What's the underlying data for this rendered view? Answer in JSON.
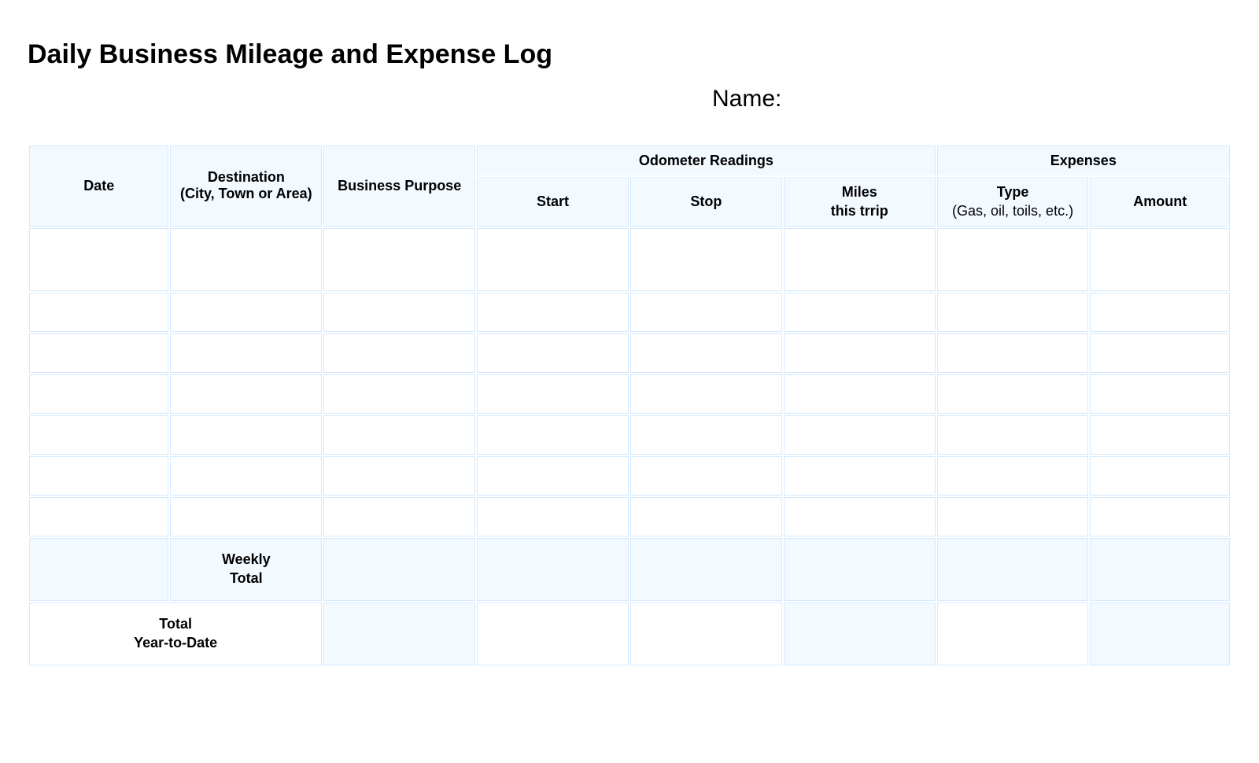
{
  "title": "Daily Business Mileage and Expense Log",
  "name_label": "Name:",
  "headers": {
    "date": "Date",
    "destination_line1": "Destination",
    "destination_line2": "(City, Town or Area)",
    "purpose": "Business Purpose",
    "odometer_group": "Odometer Readings",
    "start": "Start",
    "stop": "Stop",
    "miles_line1": "Miles",
    "miles_line2": "this trrip",
    "expenses_group": "Expenses",
    "type_line1": "Type",
    "type_line2": "(Gas, oil, toils, etc.)",
    "amount": "Amount"
  },
  "rows": [
    {
      "date": "",
      "destination": "",
      "purpose": "",
      "start": "",
      "stop": "",
      "miles": "",
      "type": "",
      "amount": ""
    },
    {
      "date": "",
      "destination": "",
      "purpose": "",
      "start": "",
      "stop": "",
      "miles": "",
      "type": "",
      "amount": ""
    },
    {
      "date": "",
      "destination": "",
      "purpose": "",
      "start": "",
      "stop": "",
      "miles": "",
      "type": "",
      "amount": ""
    },
    {
      "date": "",
      "destination": "",
      "purpose": "",
      "start": "",
      "stop": "",
      "miles": "",
      "type": "",
      "amount": ""
    },
    {
      "date": "",
      "destination": "",
      "purpose": "",
      "start": "",
      "stop": "",
      "miles": "",
      "type": "",
      "amount": ""
    },
    {
      "date": "",
      "destination": "",
      "purpose": "",
      "start": "",
      "stop": "",
      "miles": "",
      "type": "",
      "amount": ""
    },
    {
      "date": "",
      "destination": "",
      "purpose": "",
      "start": "",
      "stop": "",
      "miles": "",
      "type": "",
      "amount": ""
    }
  ],
  "totals": {
    "weekly_line1": "Weekly",
    "weekly_line2": "Total",
    "ytd_line1": "Total",
    "ytd_line2": "Year-to-Date"
  }
}
